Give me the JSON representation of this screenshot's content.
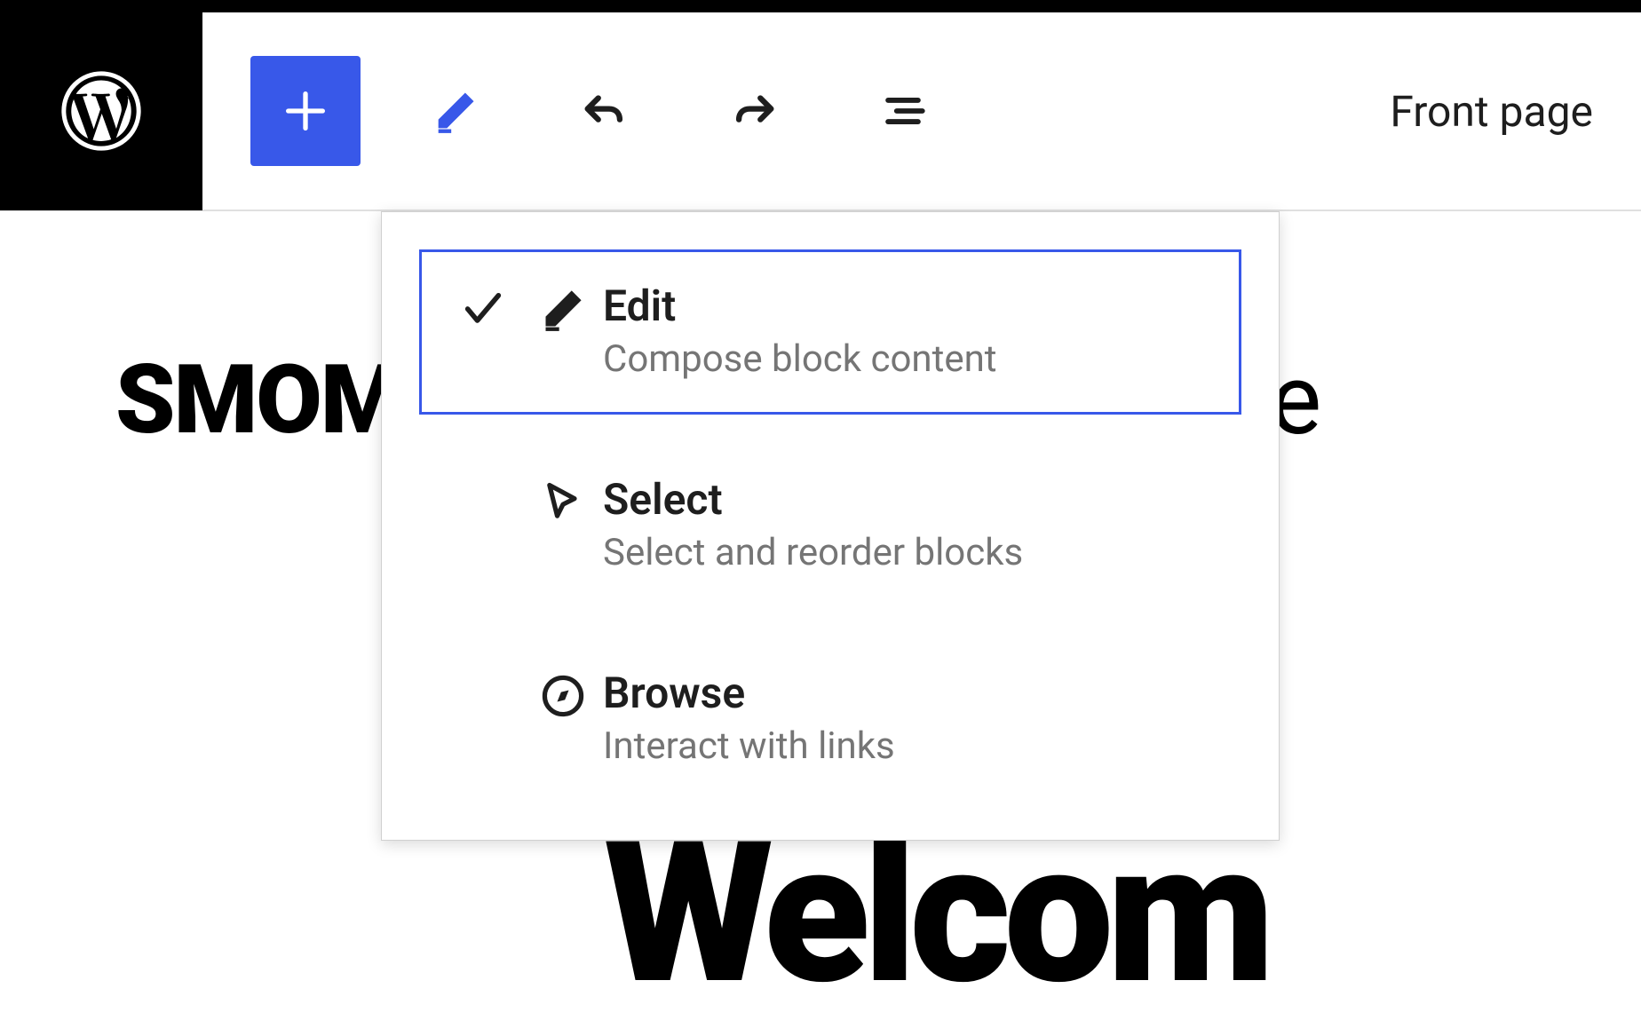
{
  "toolbar": {
    "page_label": "Front page"
  },
  "content": {
    "site_title_partial": "SMOM",
    "trailing_letter": "e",
    "welcome_partial": "Welcom"
  },
  "dropdown": {
    "items": [
      {
        "title": "Edit",
        "desc": "Compose block content",
        "selected": true,
        "icon": "pencil"
      },
      {
        "title": "Select",
        "desc": "Select and reorder blocks",
        "selected": false,
        "icon": "cursor"
      },
      {
        "title": "Browse",
        "desc": "Interact with links",
        "selected": false,
        "icon": "compass"
      }
    ]
  }
}
